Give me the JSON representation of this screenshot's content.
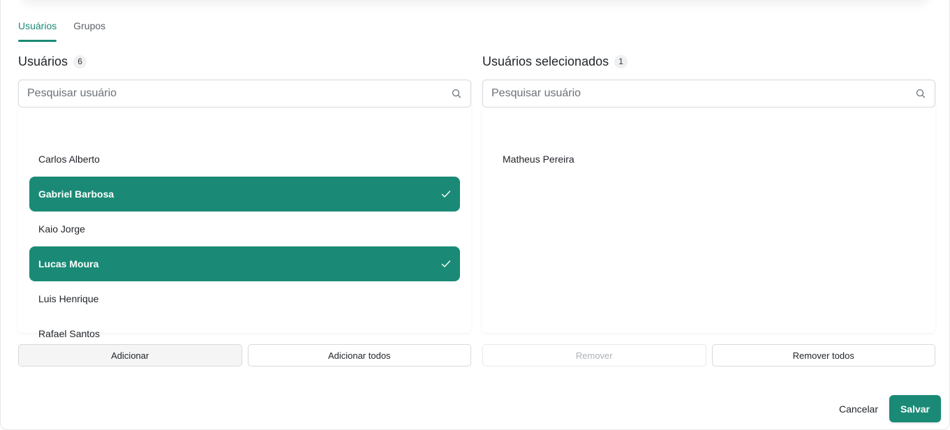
{
  "tabs": [
    {
      "label": "Usuários",
      "active": true
    },
    {
      "label": "Grupos",
      "active": false
    }
  ],
  "left": {
    "title": "Usuários",
    "count": "6",
    "search_placeholder": "Pesquisar usuário",
    "items": [
      {
        "label": "Carlos Alberto",
        "selected": false
      },
      {
        "label": "Gabriel Barbosa",
        "selected": true
      },
      {
        "label": "Kaio Jorge",
        "selected": false
      },
      {
        "label": "Lucas Moura",
        "selected": true
      },
      {
        "label": "Luis Henrique",
        "selected": false
      },
      {
        "label": "Rafael Santos",
        "selected": false
      }
    ],
    "add_label": "Adicionar",
    "add_all_label": "Adicionar todos"
  },
  "right": {
    "title": "Usuários selecionados",
    "count": "1",
    "search_placeholder": "Pesquisar usuário",
    "items": [
      {
        "label": "Matheus Pereira",
        "selected": false
      }
    ],
    "remove_label": "Remover",
    "remove_all_label": "Remover todos"
  },
  "footer": {
    "cancel_label": "Cancelar",
    "save_label": "Salvar"
  },
  "colors": {
    "accent": "#1a8a76"
  },
  "icons": {
    "search": "search-icon",
    "check": "check-icon"
  }
}
